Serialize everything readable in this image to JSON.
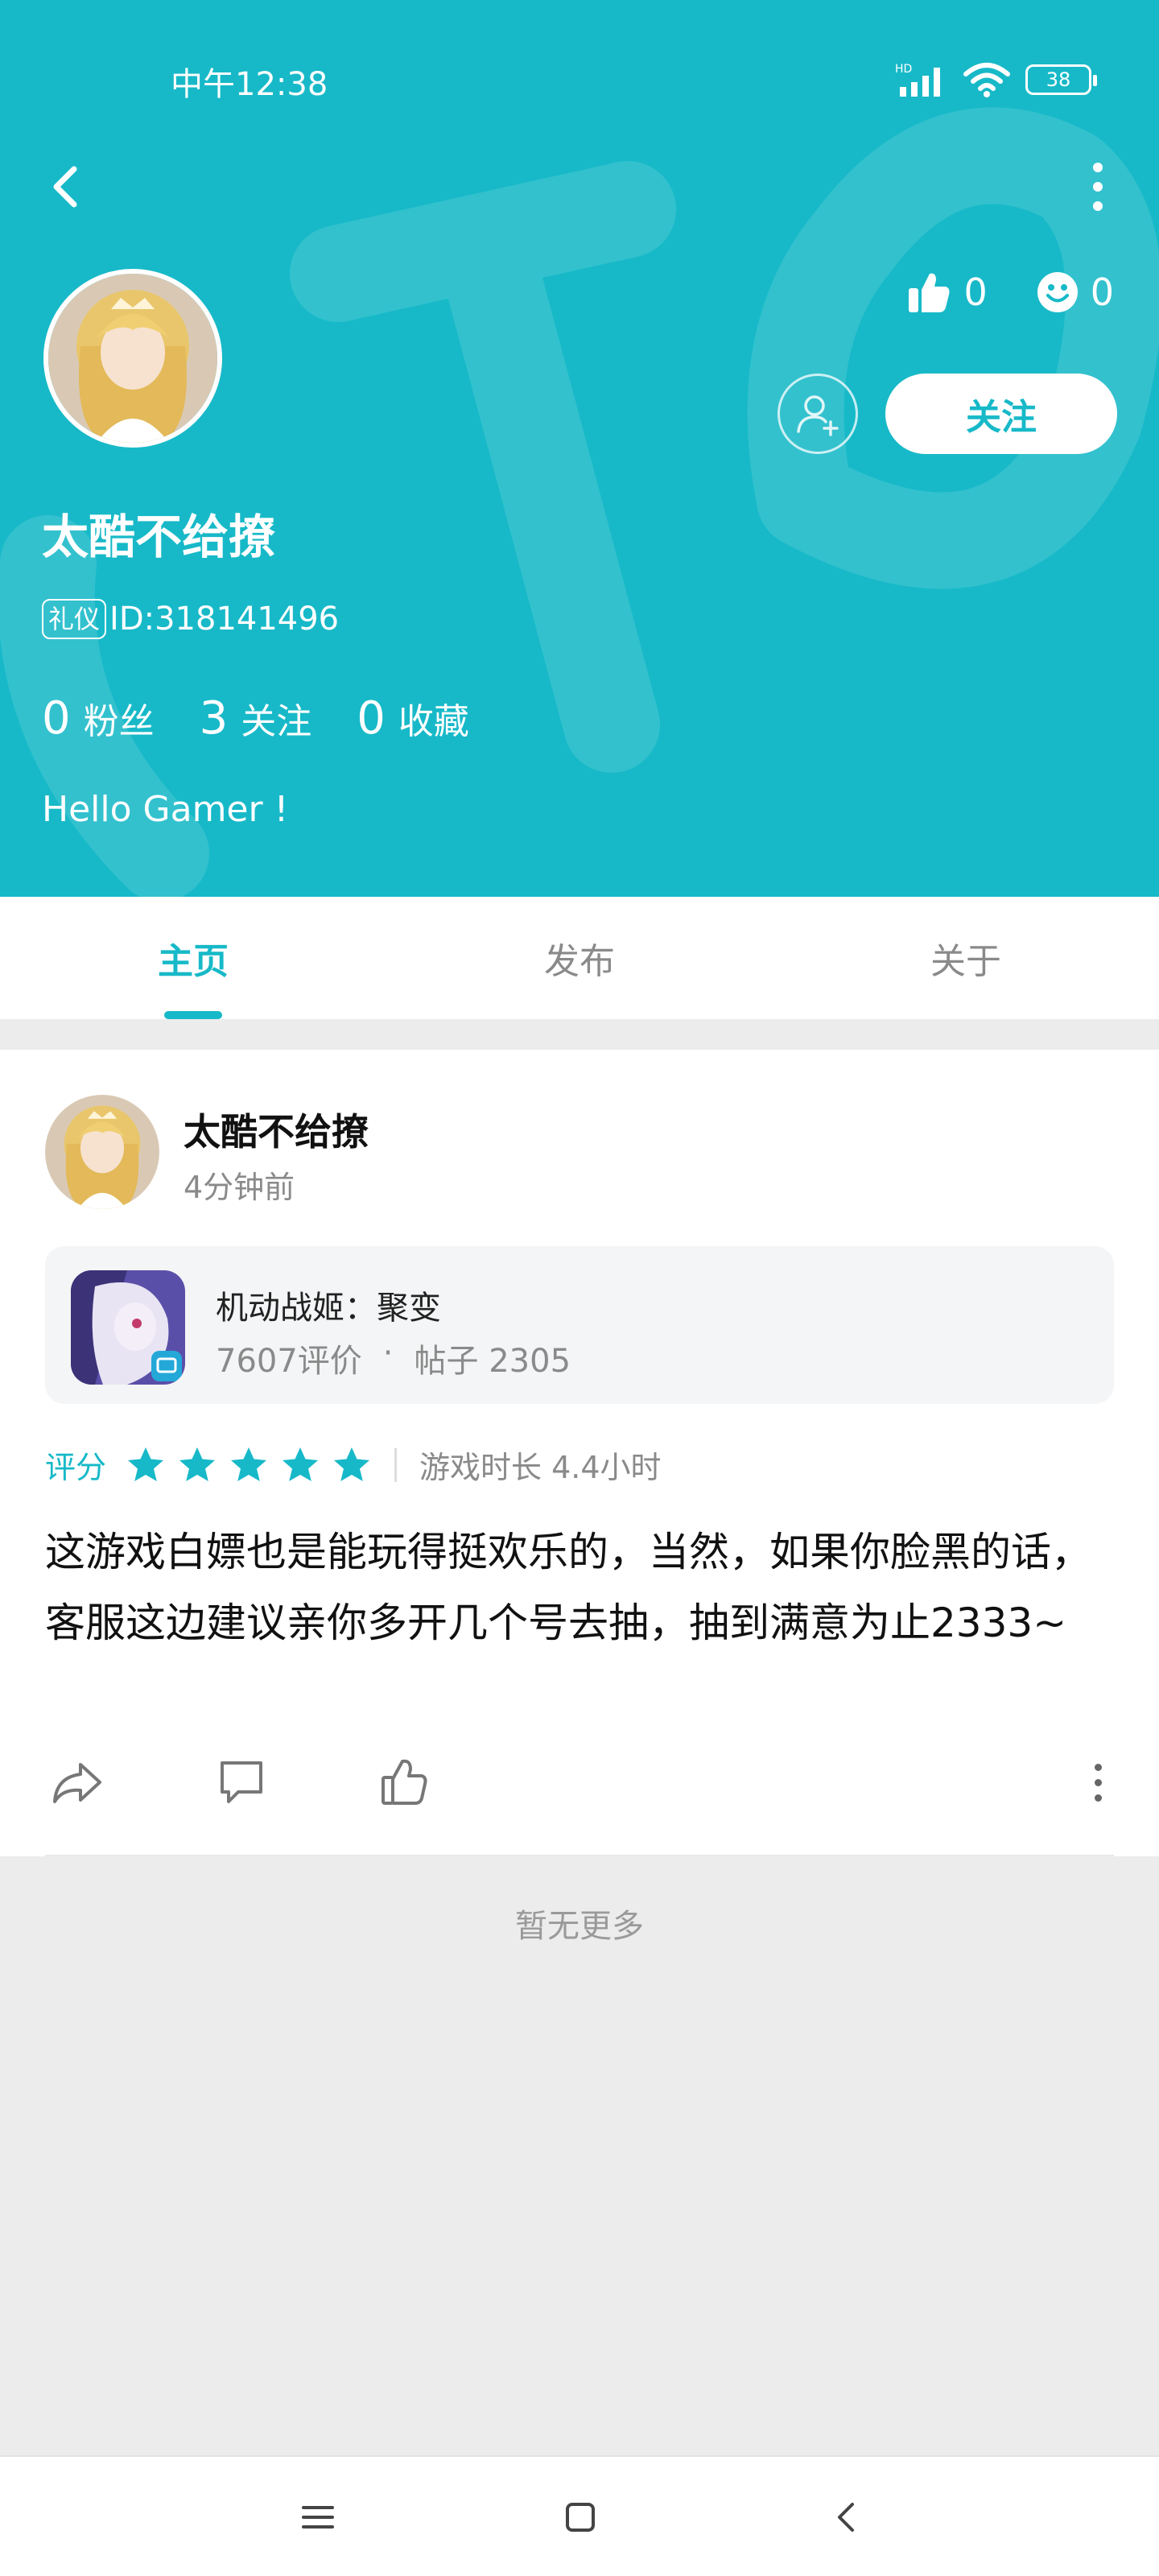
{
  "status_bar": {
    "time": "中午12:38",
    "battery": "38",
    "network": "HD"
  },
  "profile": {
    "username": "太酷不给撩",
    "badge": "礼仪",
    "id_text": "ID:318141496",
    "likes": "0",
    "smiles": "0",
    "follow_label": "关注",
    "stats": [
      {
        "num": "0",
        "label": "粉丝"
      },
      {
        "num": "3",
        "label": "关注"
      },
      {
        "num": "0",
        "label": "收藏"
      }
    ],
    "bio": "Hello Gamer !"
  },
  "tabs": [
    {
      "label": "主页",
      "active": true
    },
    {
      "label": "发布",
      "active": false
    },
    {
      "label": "关于",
      "active": false
    }
  ],
  "post": {
    "author": "太酷不给撩",
    "time": "4分钟前",
    "game": {
      "name": "机动战姬：聚变",
      "reviews": "7607评价",
      "separator": "·",
      "posts": "帖子 2305"
    },
    "rating_label": "评分",
    "rating_stars": 5,
    "playtime": "游戏时长 4.4小时",
    "text": "这游戏白嫖也是能玩得挺欢乐的，当然，如果你脸黑的话，客服这边建议亲你多开几个号去抽，抽到满意为止2333~"
  },
  "footer": {
    "no_more": "暂无更多"
  },
  "colors": {
    "accent": "#17b9c8",
    "background": "#ececec",
    "star": "#17b9c8"
  },
  "icons": [
    "back-icon",
    "more-icon",
    "thumbs-up-icon",
    "smile-icon",
    "add-friend-icon",
    "share-icon",
    "comment-icon",
    "like-icon",
    "menu-icon",
    "home-icon",
    "nav-back-icon"
  ]
}
